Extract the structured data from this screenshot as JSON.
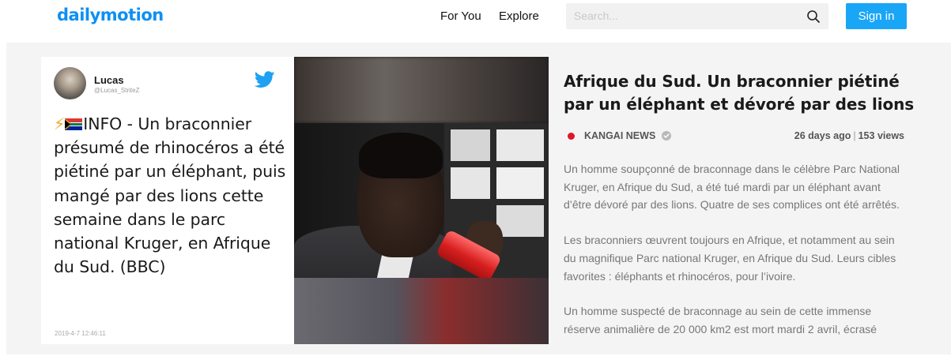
{
  "header": {
    "logo": "dailymotion",
    "nav": [
      {
        "label": "For You"
      },
      {
        "label": "Explore"
      }
    ],
    "search_placeholder": "Search...",
    "signin_label": "Sign in"
  },
  "tweet": {
    "name": "Lucas",
    "handle": "@Lucas_StriteZ",
    "prefix": "⚡",
    "text": "INFO - Un braconnier présumé de rhinocéros a été piétiné par un éléphant, puis mangé par des lions cette semaine dans le parc national Kruger, en Afrique du Sud. (BBC)",
    "date": "2019-4-7 12:46:11"
  },
  "video": {
    "title": "Afrique du Sud. Un braconnier piétiné par un éléphant et dévoré par des lions",
    "channel": "KANGAI NEWS",
    "age": "26 days ago",
    "views": "153 views",
    "description": [
      "Un homme soupçonné de braconnage dans le célèbre Parc National Kruger, en Afrique du Sud, a été tué mardi par un éléphant avant d’être dévoré par des lions. Quatre de ses complices ont été arrêtés.",
      "Les braconniers œuvrent toujours en Afrique, et notamment au sein du magnifique Parc national Kruger, en Afrique du Sud. Leurs cibles favorites : éléphants et rhinocéros, pour l’ivoire.",
      "Un homme suspecté de braconnage au sein de cette immense réserve animalière de 20 000 km2 est mort mardi 2 avril, écrasé"
    ]
  },
  "colors": {
    "brand": "#0d90f3",
    "signin": "#1aa6f7",
    "twitter": "#1da1f2",
    "channel_dot": "#e0162b"
  },
  "icons": [
    "search-icon",
    "twitter-bird-icon",
    "verified-check-icon",
    "south-africa-flag-icon",
    "lightning-icon"
  ]
}
